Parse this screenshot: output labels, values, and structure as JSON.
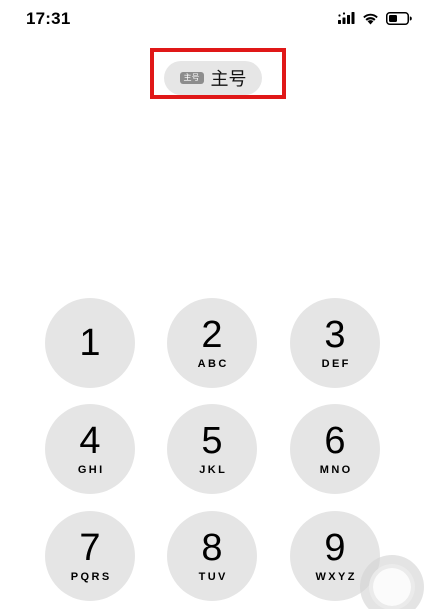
{
  "status_bar": {
    "time": "17:31",
    "icons": [
      "signal-icon",
      "wifi-icon",
      "battery-icon"
    ]
  },
  "line_selector": {
    "badge": "主号",
    "label": "主号",
    "highlight_color": "#e01818"
  },
  "keypad": {
    "keys": [
      {
        "digit": "1",
        "letters": ""
      },
      {
        "digit": "2",
        "letters": "ABC"
      },
      {
        "digit": "3",
        "letters": "DEF"
      },
      {
        "digit": "4",
        "letters": "GHI"
      },
      {
        "digit": "5",
        "letters": "JKL"
      },
      {
        "digit": "6",
        "letters": "MNO"
      },
      {
        "digit": "7",
        "letters": "PQRS"
      },
      {
        "digit": "8",
        "letters": "TUV"
      },
      {
        "digit": "9",
        "letters": "WXYZ"
      }
    ],
    "key_color": "#e5e5e5"
  },
  "assistive_touch": {
    "icon": "assistive-touch-icon"
  }
}
